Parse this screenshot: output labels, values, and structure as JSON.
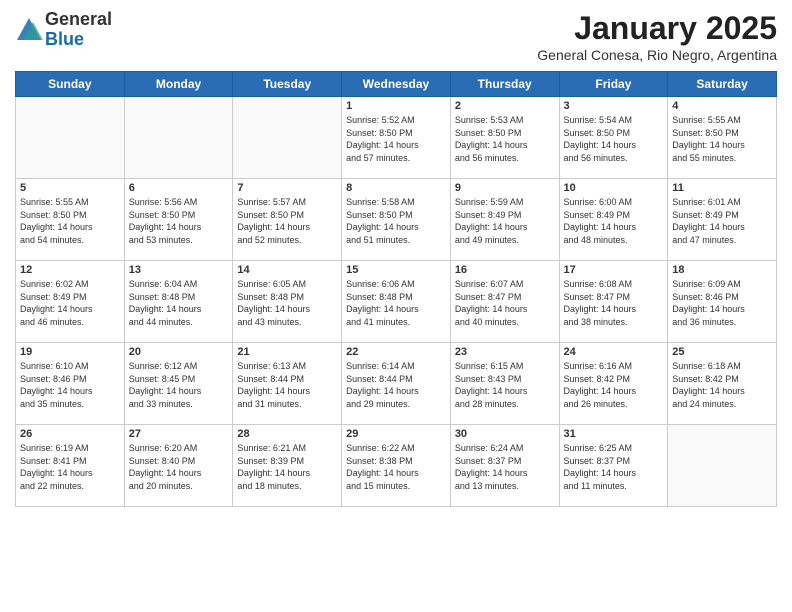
{
  "logo": {
    "general": "General",
    "blue": "Blue"
  },
  "header": {
    "month": "January 2025",
    "location": "General Conesa, Rio Negro, Argentina"
  },
  "weekdays": [
    "Sunday",
    "Monday",
    "Tuesday",
    "Wednesday",
    "Thursday",
    "Friday",
    "Saturday"
  ],
  "weeks": [
    [
      {
        "day": "",
        "sunrise": "",
        "sunset": "",
        "daylight": ""
      },
      {
        "day": "",
        "sunrise": "",
        "sunset": "",
        "daylight": ""
      },
      {
        "day": "",
        "sunrise": "",
        "sunset": "",
        "daylight": ""
      },
      {
        "day": "1",
        "sunrise": "5:52 AM",
        "sunset": "8:50 PM",
        "daylight": "14 hours and 57 minutes."
      },
      {
        "day": "2",
        "sunrise": "5:53 AM",
        "sunset": "8:50 PM",
        "daylight": "14 hours and 56 minutes."
      },
      {
        "day": "3",
        "sunrise": "5:54 AM",
        "sunset": "8:50 PM",
        "daylight": "14 hours and 56 minutes."
      },
      {
        "day": "4",
        "sunrise": "5:55 AM",
        "sunset": "8:50 PM",
        "daylight": "14 hours and 55 minutes."
      }
    ],
    [
      {
        "day": "5",
        "sunrise": "5:55 AM",
        "sunset": "8:50 PM",
        "daylight": "14 hours and 54 minutes."
      },
      {
        "day": "6",
        "sunrise": "5:56 AM",
        "sunset": "8:50 PM",
        "daylight": "14 hours and 53 minutes."
      },
      {
        "day": "7",
        "sunrise": "5:57 AM",
        "sunset": "8:50 PM",
        "daylight": "14 hours and 52 minutes."
      },
      {
        "day": "8",
        "sunrise": "5:58 AM",
        "sunset": "8:50 PM",
        "daylight": "14 hours and 51 minutes."
      },
      {
        "day": "9",
        "sunrise": "5:59 AM",
        "sunset": "8:49 PM",
        "daylight": "14 hours and 49 minutes."
      },
      {
        "day": "10",
        "sunrise": "6:00 AM",
        "sunset": "8:49 PM",
        "daylight": "14 hours and 48 minutes."
      },
      {
        "day": "11",
        "sunrise": "6:01 AM",
        "sunset": "8:49 PM",
        "daylight": "14 hours and 47 minutes."
      }
    ],
    [
      {
        "day": "12",
        "sunrise": "6:02 AM",
        "sunset": "8:49 PM",
        "daylight": "14 hours and 46 minutes."
      },
      {
        "day": "13",
        "sunrise": "6:04 AM",
        "sunset": "8:48 PM",
        "daylight": "14 hours and 44 minutes."
      },
      {
        "day": "14",
        "sunrise": "6:05 AM",
        "sunset": "8:48 PM",
        "daylight": "14 hours and 43 minutes."
      },
      {
        "day": "15",
        "sunrise": "6:06 AM",
        "sunset": "8:48 PM",
        "daylight": "14 hours and 41 minutes."
      },
      {
        "day": "16",
        "sunrise": "6:07 AM",
        "sunset": "8:47 PM",
        "daylight": "14 hours and 40 minutes."
      },
      {
        "day": "17",
        "sunrise": "6:08 AM",
        "sunset": "8:47 PM",
        "daylight": "14 hours and 38 minutes."
      },
      {
        "day": "18",
        "sunrise": "6:09 AM",
        "sunset": "8:46 PM",
        "daylight": "14 hours and 36 minutes."
      }
    ],
    [
      {
        "day": "19",
        "sunrise": "6:10 AM",
        "sunset": "8:46 PM",
        "daylight": "14 hours and 35 minutes."
      },
      {
        "day": "20",
        "sunrise": "6:12 AM",
        "sunset": "8:45 PM",
        "daylight": "14 hours and 33 minutes."
      },
      {
        "day": "21",
        "sunrise": "6:13 AM",
        "sunset": "8:44 PM",
        "daylight": "14 hours and 31 minutes."
      },
      {
        "day": "22",
        "sunrise": "6:14 AM",
        "sunset": "8:44 PM",
        "daylight": "14 hours and 29 minutes."
      },
      {
        "day": "23",
        "sunrise": "6:15 AM",
        "sunset": "8:43 PM",
        "daylight": "14 hours and 28 minutes."
      },
      {
        "day": "24",
        "sunrise": "6:16 AM",
        "sunset": "8:42 PM",
        "daylight": "14 hours and 26 minutes."
      },
      {
        "day": "25",
        "sunrise": "6:18 AM",
        "sunset": "8:42 PM",
        "daylight": "14 hours and 24 minutes."
      }
    ],
    [
      {
        "day": "26",
        "sunrise": "6:19 AM",
        "sunset": "8:41 PM",
        "daylight": "14 hours and 22 minutes."
      },
      {
        "day": "27",
        "sunrise": "6:20 AM",
        "sunset": "8:40 PM",
        "daylight": "14 hours and 20 minutes."
      },
      {
        "day": "28",
        "sunrise": "6:21 AM",
        "sunset": "8:39 PM",
        "daylight": "14 hours and 18 minutes."
      },
      {
        "day": "29",
        "sunrise": "6:22 AM",
        "sunset": "8:38 PM",
        "daylight": "14 hours and 15 minutes."
      },
      {
        "day": "30",
        "sunrise": "6:24 AM",
        "sunset": "8:37 PM",
        "daylight": "14 hours and 13 minutes."
      },
      {
        "day": "31",
        "sunrise": "6:25 AM",
        "sunset": "8:37 PM",
        "daylight": "14 hours and 11 minutes."
      },
      {
        "day": "",
        "sunrise": "",
        "sunset": "",
        "daylight": ""
      }
    ]
  ]
}
